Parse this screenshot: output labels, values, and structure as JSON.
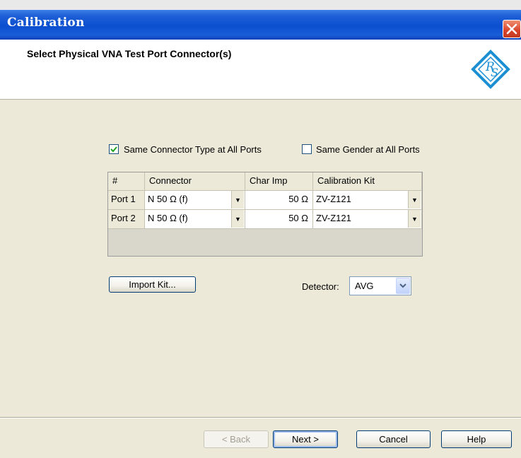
{
  "window": {
    "title": "Calibration"
  },
  "header": {
    "title": "Select Physical VNA Test Port Connector(s)"
  },
  "options": {
    "same_connector": {
      "label": "Same Connector Type at All Ports",
      "checked": true
    },
    "same_gender": {
      "label": "Same Gender at All Ports",
      "checked": false
    }
  },
  "table": {
    "columns": [
      "#",
      "Connector",
      "Char Imp",
      "Calibration Kit"
    ],
    "rows": [
      {
        "port": "Port 1",
        "connector": "N 50 Ω (f)",
        "char_imp": "50 Ω",
        "kit": "ZV-Z121"
      },
      {
        "port": "Port 2",
        "connector": "N 50 Ω (f)",
        "char_imp": "50 Ω",
        "kit": "ZV-Z121"
      }
    ]
  },
  "import_kit_label": "Import Kit...",
  "detector": {
    "label": "Detector:",
    "value": "AVG"
  },
  "buttons": {
    "back": "< Back",
    "next": "Next >",
    "cancel": "Cancel",
    "help": "Help"
  },
  "colors": {
    "title_bar": "#0b4fd0",
    "dialog_bg": "#ece9d8",
    "close_button": "#d9432a",
    "logo_blue": "#1b8fd2"
  },
  "icons": {
    "close": "close-icon",
    "logo": "rs-logo-icon",
    "check": "checkmark-icon",
    "dropdown": "chevron-down-icon"
  }
}
